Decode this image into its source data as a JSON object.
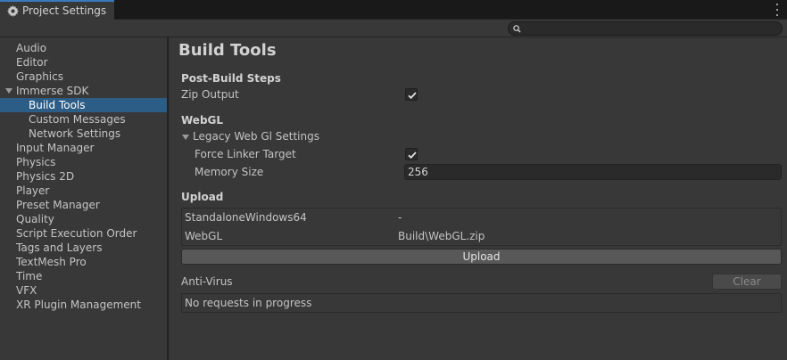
{
  "window": {
    "tab_title": "Project Settings"
  },
  "search": {
    "placeholder": ""
  },
  "sidebar": {
    "items": [
      {
        "label": "Audio",
        "level": 0
      },
      {
        "label": "Editor",
        "level": 0
      },
      {
        "label": "Graphics",
        "level": 0
      },
      {
        "label": "Immerse SDK",
        "level": 0,
        "expanded": true
      },
      {
        "label": "Build Tools",
        "level": 1,
        "selected": true
      },
      {
        "label": "Custom Messages",
        "level": 1
      },
      {
        "label": "Network Settings",
        "level": 1
      },
      {
        "label": "Input Manager",
        "level": 0
      },
      {
        "label": "Physics",
        "level": 0
      },
      {
        "label": "Physics 2D",
        "level": 0
      },
      {
        "label": "Player",
        "level": 0
      },
      {
        "label": "Preset Manager",
        "level": 0
      },
      {
        "label": "Quality",
        "level": 0
      },
      {
        "label": "Script Execution Order",
        "level": 0
      },
      {
        "label": "Tags and Layers",
        "level": 0
      },
      {
        "label": "TextMesh Pro",
        "level": 0
      },
      {
        "label": "Time",
        "level": 0
      },
      {
        "label": "VFX",
        "level": 0
      },
      {
        "label": "XR Plugin Management",
        "level": 0
      }
    ]
  },
  "main": {
    "title": "Build Tools",
    "post_build": {
      "header": "Post-Build Steps",
      "zip_output_label": "Zip Output",
      "zip_output_checked": true
    },
    "webgl": {
      "header": "WebGL",
      "legacy_foldout": "Legacy Web Gl Settings",
      "force_linker_label": "Force Linker Target",
      "force_linker_checked": true,
      "memory_size_label": "Memory Size",
      "memory_size_value": "256"
    },
    "upload": {
      "header": "Upload",
      "rows": [
        {
          "platform": "StandaloneWindows64",
          "path": "-"
        },
        {
          "platform": "WebGL",
          "path": "Build\\WebGL.zip"
        }
      ],
      "button_label": "Upload"
    },
    "anti_virus": {
      "label": "Anti-Virus",
      "clear_label": "Clear",
      "status": "No requests in progress"
    }
  },
  "colors": {
    "selection": "#2c5d87",
    "panel": "#383838",
    "accent_tab": "#3a79bb"
  }
}
